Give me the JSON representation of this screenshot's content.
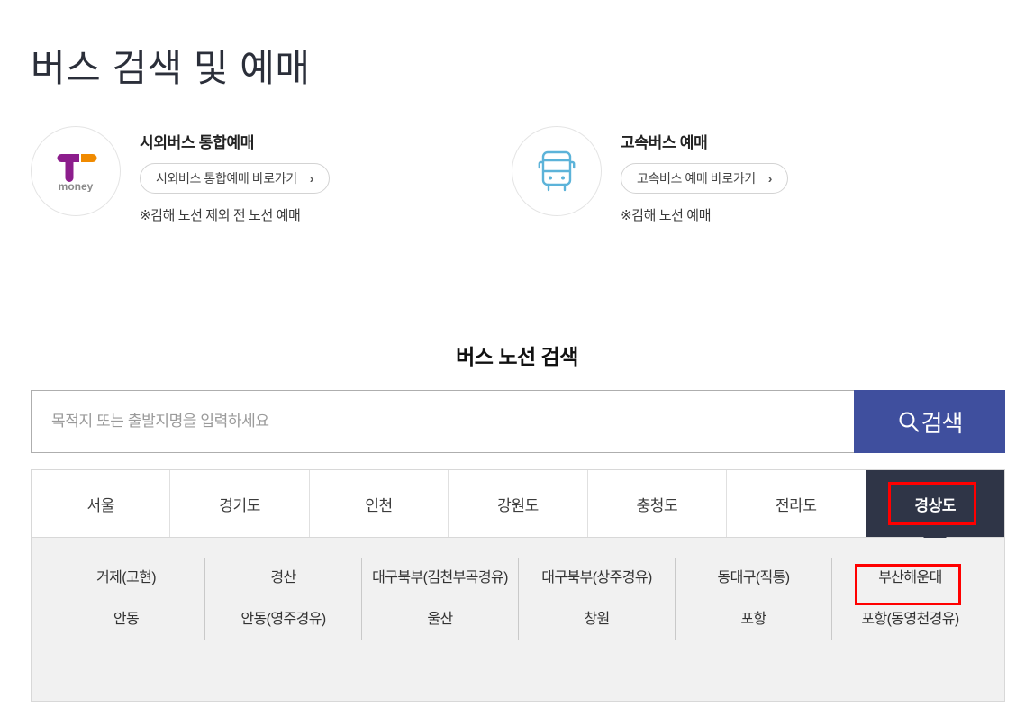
{
  "page": {
    "title": "버스 검색 및 예매"
  },
  "booking_cards": [
    {
      "icon": "tmoney-logo-icon",
      "title": "시외버스 통합예매",
      "button_label": "시외버스 통합예매 바로가기",
      "chevron": "›",
      "note": "※김해 노선 제외 전 노선 예매"
    },
    {
      "icon": "bus-front-icon",
      "title": "고속버스 예매",
      "button_label": "고속버스 예매 바로가기",
      "chevron": "›",
      "note": "※김해 노선 예매"
    }
  ],
  "search": {
    "heading": "버스 노선 검색",
    "placeholder": "목적지 또는 출발지명을 입력하세요",
    "value": "",
    "button_label": "검색",
    "button_icon": "search-icon",
    "button_color": "#3f4f9e"
  },
  "tabs": {
    "items": [
      {
        "label": "서울",
        "active": false
      },
      {
        "label": "경기도",
        "active": false
      },
      {
        "label": "인천",
        "active": false
      },
      {
        "label": "강원도",
        "active": false
      },
      {
        "label": "충청도",
        "active": false
      },
      {
        "label": "전라도",
        "active": false
      },
      {
        "label": "경상도",
        "active": true
      }
    ],
    "active_color": "#2f3547",
    "highlight_color": "#ff0000"
  },
  "regions": {
    "items": [
      "거제(고현)",
      "경산",
      "대구북부(김천부곡경유)",
      "대구북부(상주경유)",
      "동대구(직통)",
      "부산해운대",
      "안동",
      "안동(영주경유)",
      "울산",
      "창원",
      "포항",
      "포항(동영천경유)"
    ],
    "highlighted": "부산해운대"
  }
}
